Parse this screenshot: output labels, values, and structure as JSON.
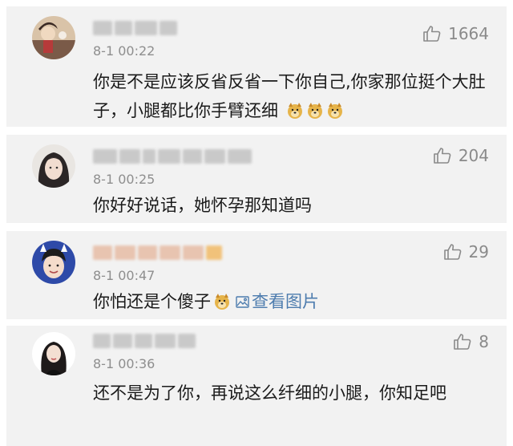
{
  "comments": [
    {
      "time": "8-1 00:22",
      "likes": "1664",
      "text": "你是不是应该反省反省一下你自己,你家那位挺个大肚子，小腿都比你手臂还细"
    },
    {
      "time": "8-1 00:25",
      "likes": "204",
      "text": "你好好说话，她怀孕那知道吗"
    },
    {
      "time": "8-1 00:47",
      "likes": "29",
      "text": "你怕还是个傻子",
      "link_text": "查看图片"
    },
    {
      "time": "8-1 00:36",
      "likes": "8",
      "text": "还不是为了你，再说这么纤细的小腿，你知足吧"
    }
  ],
  "icons": {
    "like": "thumbs-up-icon",
    "emoji": "doge-emoji-icon",
    "picture": "picture-icon"
  },
  "colors": {
    "card_bg": "#f2f2f2",
    "time": "#8e8e8e",
    "link": "#4d7cae",
    "text": "#1a1a1a"
  }
}
